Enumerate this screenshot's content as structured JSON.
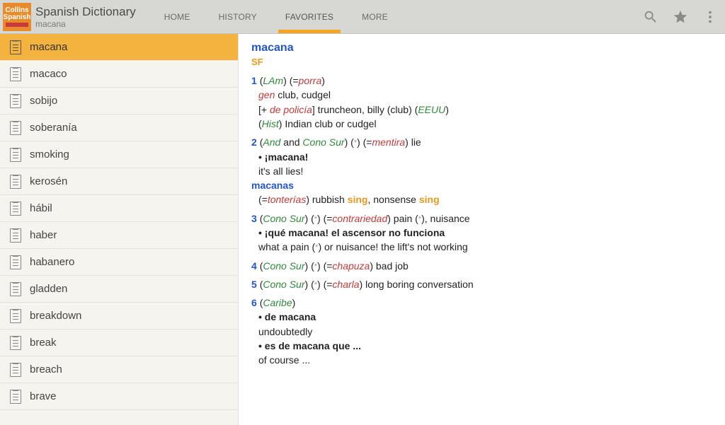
{
  "header": {
    "logo": {
      "line1": "Collins",
      "line2": "Spanish",
      "bar": ""
    },
    "title": "Spanish Dictionary",
    "subtitle": "macana",
    "tabs": [
      {
        "id": "home",
        "label": "HOME",
        "active": false
      },
      {
        "id": "history",
        "label": "HISTORY",
        "active": false
      },
      {
        "id": "favorites",
        "label": "FAVORITES",
        "active": true
      },
      {
        "id": "more",
        "label": "MORE",
        "active": false
      }
    ],
    "icons": {
      "search": "search-icon",
      "star": "star-icon",
      "overflow": "overflow-icon"
    }
  },
  "sidebar": {
    "items": [
      {
        "word": "macana",
        "selected": true
      },
      {
        "word": "macaco",
        "selected": false
      },
      {
        "word": "sobijo",
        "selected": false
      },
      {
        "word": "soberanía",
        "selected": false
      },
      {
        "word": "smoking",
        "selected": false
      },
      {
        "word": "kerosén",
        "selected": false
      },
      {
        "word": "hábil",
        "selected": false
      },
      {
        "word": "haber",
        "selected": false
      },
      {
        "word": "habanero",
        "selected": false
      },
      {
        "word": "gladden",
        "selected": false
      },
      {
        "word": "breakdown",
        "selected": false
      },
      {
        "word": "break",
        "selected": false
      },
      {
        "word": "breach",
        "selected": false
      },
      {
        "word": "brave",
        "selected": false
      }
    ]
  },
  "entry": {
    "headword": "macana",
    "pos": "SF",
    "senses": [
      {
        "num": "1",
        "lines": [
          {
            "segments": [
              {
                "t": "(",
                "c": "plain"
              },
              {
                "t": "LAm",
                "c": "region"
              },
              {
                "t": ") (=",
                "c": "plain"
              },
              {
                "t": "porra",
                "c": "xref"
              },
              {
                "t": ")",
                "c": "plain"
              }
            ]
          },
          {
            "indent": true,
            "segments": [
              {
                "t": "gen",
                "c": "gram"
              },
              {
                "t": " club, cudgel",
                "c": "plain"
              }
            ]
          },
          {
            "indent": true,
            "segments": [
              {
                "t": "[+ ",
                "c": "plain"
              },
              {
                "t": "de policía",
                "c": "xref"
              },
              {
                "t": "] truncheon, billy (club) (",
                "c": "plain"
              },
              {
                "t": "EEUU",
                "c": "region"
              },
              {
                "t": ")",
                "c": "plain"
              }
            ]
          },
          {
            "indent": true,
            "segments": [
              {
                "t": "(",
                "c": "plain"
              },
              {
                "t": "Hist",
                "c": "region"
              },
              {
                "t": ") Indian club ",
                "c": "plain"
              },
              {
                "t": "or",
                "c": "plain"
              },
              {
                "t": " cudgel",
                "c": "plain"
              }
            ]
          }
        ]
      },
      {
        "num": "2",
        "lines": [
          {
            "segments": [
              {
                "t": "(",
                "c": "plain"
              },
              {
                "t": "And",
                "c": "region"
              },
              {
                "t": " and ",
                "c": "plain"
              },
              {
                "t": "Cono Sur",
                "c": "region"
              },
              {
                "t": ") (",
                "c": "plain"
              },
              {
                "t": "*",
                "c": "star"
              },
              {
                "t": ") (=",
                "c": "plain"
              },
              {
                "t": "mentira",
                "c": "xref"
              },
              {
                "t": ") lie",
                "c": "plain"
              }
            ]
          },
          {
            "indent": true,
            "segments": [
              {
                "t": "• ",
                "c": "bullet"
              },
              {
                "t": "¡macana!",
                "c": "bold"
              }
            ]
          },
          {
            "indent": true,
            "segments": [
              {
                "t": "it's all lies!",
                "c": "plain"
              }
            ]
          },
          {
            "segments": [
              {
                "t": "macanas",
                "c": "subhead"
              }
            ]
          },
          {
            "indent": true,
            "segments": [
              {
                "t": "(=",
                "c": "plain"
              },
              {
                "t": "tonterías",
                "c": "xref"
              },
              {
                "t": ") rubbish ",
                "c": "plain"
              },
              {
                "t": "sing",
                "c": "xlink"
              },
              {
                "t": ", nonsense ",
                "c": "plain"
              },
              {
                "t": "sing",
                "c": "xlink"
              }
            ]
          }
        ]
      },
      {
        "num": "3",
        "lines": [
          {
            "segments": [
              {
                "t": "(",
                "c": "plain"
              },
              {
                "t": "Cono Sur",
                "c": "region"
              },
              {
                "t": ") (",
                "c": "plain"
              },
              {
                "t": "*",
                "c": "star"
              },
              {
                "t": ") (=",
                "c": "plain"
              },
              {
                "t": "contrariedad",
                "c": "xref"
              },
              {
                "t": ") pain (",
                "c": "plain"
              },
              {
                "t": "*",
                "c": "star"
              },
              {
                "t": "), nuisance",
                "c": "plain"
              }
            ]
          },
          {
            "indent": true,
            "segments": [
              {
                "t": "• ",
                "c": "bullet"
              },
              {
                "t": "¡qué macana! el ascensor no funciona",
                "c": "bold"
              }
            ]
          },
          {
            "indent": true,
            "segments": [
              {
                "t": "what a pain (",
                "c": "plain"
              },
              {
                "t": "*",
                "c": "star"
              },
              {
                "t": ") ",
                "c": "plain"
              },
              {
                "t": "or",
                "c": "plain"
              },
              {
                "t": " nuisance! the lift's not working",
                "c": "plain"
              }
            ]
          }
        ]
      },
      {
        "num": "4",
        "lines": [
          {
            "segments": [
              {
                "t": "(",
                "c": "plain"
              },
              {
                "t": "Cono Sur",
                "c": "region"
              },
              {
                "t": ") (",
                "c": "plain"
              },
              {
                "t": "*",
                "c": "star"
              },
              {
                "t": ") (=",
                "c": "plain"
              },
              {
                "t": "chapuza",
                "c": "xref"
              },
              {
                "t": ") bad job",
                "c": "plain"
              }
            ]
          }
        ]
      },
      {
        "num": "5",
        "lines": [
          {
            "segments": [
              {
                "t": "(",
                "c": "plain"
              },
              {
                "t": "Cono Sur",
                "c": "region"
              },
              {
                "t": ") (",
                "c": "plain"
              },
              {
                "t": "*",
                "c": "star"
              },
              {
                "t": ") (=",
                "c": "plain"
              },
              {
                "t": "charla",
                "c": "xref"
              },
              {
                "t": ") long boring conversation",
                "c": "plain"
              }
            ]
          }
        ]
      },
      {
        "num": "6",
        "lines": [
          {
            "segments": [
              {
                "t": "(",
                "c": "plain"
              },
              {
                "t": "Caribe",
                "c": "region"
              },
              {
                "t": ")",
                "c": "plain"
              }
            ]
          },
          {
            "indent": true,
            "segments": [
              {
                "t": "• ",
                "c": "bullet"
              },
              {
                "t": "de macana",
                "c": "bold"
              }
            ]
          },
          {
            "indent": true,
            "segments": [
              {
                "t": "undoubtedly",
                "c": "plain"
              }
            ]
          },
          {
            "indent": true,
            "segments": [
              {
                "t": "• ",
                "c": "bullet"
              },
              {
                "t": "es de macana que ...",
                "c": "bold"
              }
            ]
          },
          {
            "indent": true,
            "segments": [
              {
                "t": "of course ...",
                "c": "plain"
              }
            ]
          }
        ]
      }
    ]
  }
}
